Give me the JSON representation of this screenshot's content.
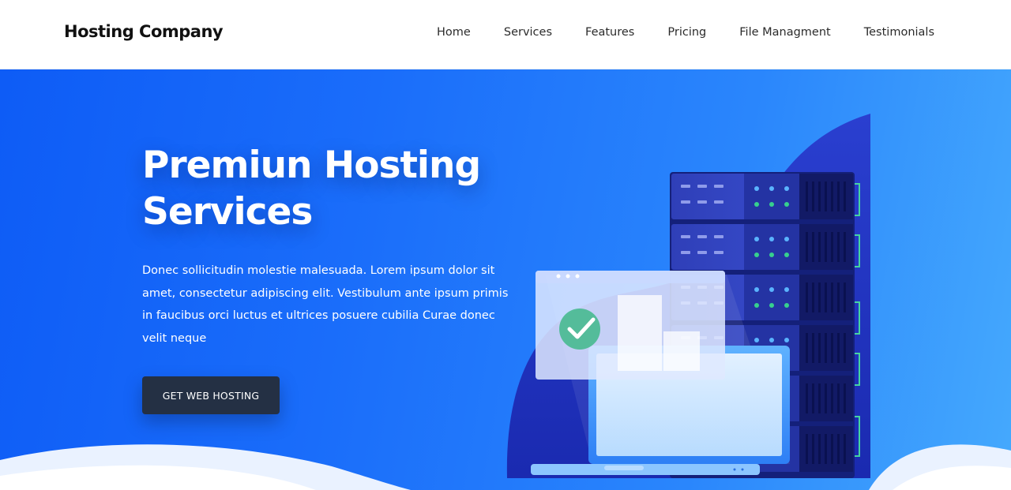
{
  "brand": "Hosting Company",
  "nav": {
    "items": [
      "Home",
      "Services",
      "Features",
      "Pricing",
      "File Managment",
      "Testimonials"
    ]
  },
  "hero": {
    "title_line1": "Premiun Hosting",
    "title_line2": "Services",
    "description": "Donec sollicitudin molestie malesuada. Lorem ipsum dolor sit amet, consectetur adipiscing elit. Vestibulum ante ipsum primis in faucibus orci luctus et ultrices posuere cubilia Curae donec velit neque",
    "cta_label": "GET WEB HOSTING"
  },
  "colors": {
    "hero_start": "#0e5cf6",
    "hero_end": "#45a9fd",
    "cta_bg": "#243044",
    "server_dark": "#1b2a8c",
    "check_green": "#3fb98a"
  },
  "icons": [
    "server-rack-illustration",
    "laptop-illustration",
    "browser-window-illustration",
    "checkmark-icon"
  ]
}
